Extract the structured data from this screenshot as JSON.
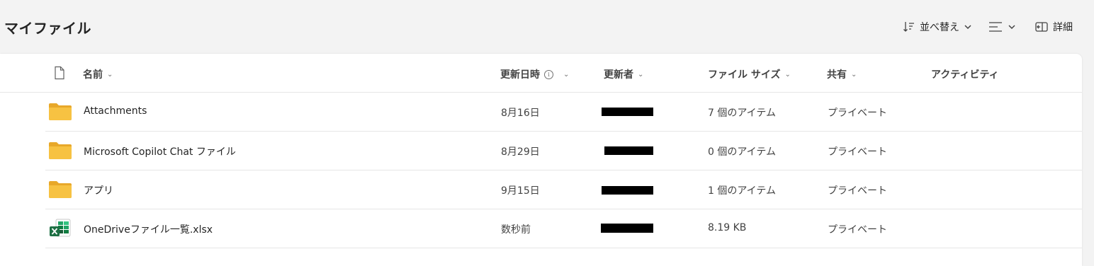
{
  "page": {
    "title": "マイファイル"
  },
  "toolbar": {
    "sort_label": "並べ替え",
    "details_label": "詳細"
  },
  "columns": {
    "name": "名前",
    "modified": "更新日時",
    "modified_by": "更新者",
    "file_size": "ファイル サイズ",
    "sharing": "共有",
    "activity": "アクティビティ"
  },
  "files": [
    {
      "name": "Attachments",
      "type": "folder",
      "modified": "8月16日",
      "modified_by": "",
      "size": "7 個のアイテム",
      "sharing": "プライベート"
    },
    {
      "name": "Microsoft Copilot Chat ファイル",
      "type": "folder",
      "modified": "8月29日",
      "modified_by": "",
      "size": "0 個のアイテム",
      "sharing": "プライベート"
    },
    {
      "name": "アプリ",
      "type": "folder",
      "modified": "9月15日",
      "modified_by": "",
      "size": "1 個のアイテム",
      "sharing": "プライベート"
    },
    {
      "name": "OneDriveファイル一覧.xlsx",
      "type": "excel",
      "modified": "数秒前",
      "modified_by": "",
      "size": "8.19 KB",
      "sharing": "プライベート"
    }
  ],
  "colors": {
    "folder": "#f7c242",
    "excel_green": "#1d7044",
    "background": "#f3f3f3"
  }
}
